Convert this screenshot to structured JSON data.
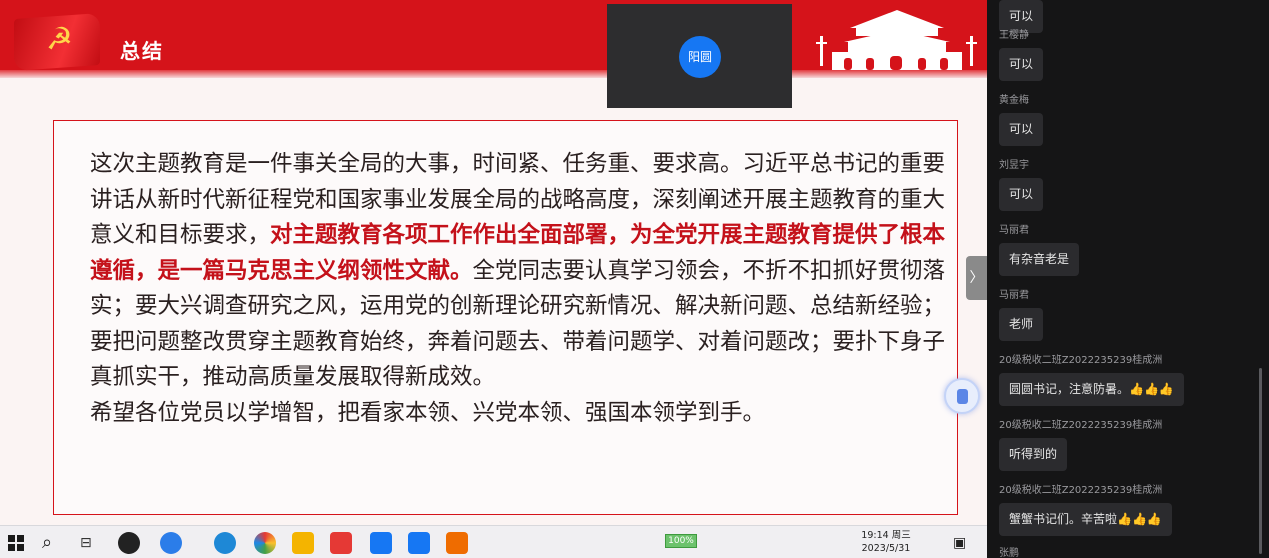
{
  "slide": {
    "title": "总结",
    "paragraph1_a": "这次主题教育是一件事关全局的大事，时间紧、任务重、要求高。习近平总书记的重要讲话从新时代新征程党和国家事业发展全局的战略高度，深刻阐述开展主题教育的重大意义和目标要求，",
    "paragraph1_strong": "对主题教育各项工作作出全面部署，为全党开展主题教育提供了根本遵循，是一篇马克思主义纲领性文献。",
    "paragraph1_b": "全党同志要认真学习领会，不折不扣抓好贯彻落实；要大兴调查研究之风，运用党的创新理论研究新情况、解决新问题、总结新经验；要把问题整改贯穿主题教育始终，奔着问题去、带着问题学、对着问题改；要扑下身子真抓实干，推动高质量发展取得新成效。",
    "paragraph2": "希望各位党员以学增智，把看家本领、兴党本领、强国本领学到手。"
  },
  "video": {
    "participant_name": "阳圆"
  },
  "chat": {
    "messages": [
      {
        "sender": "",
        "text": "可以"
      },
      {
        "sender": "王樱静",
        "text": "可以"
      },
      {
        "sender": "黄金梅",
        "text": "可以"
      },
      {
        "sender": "刘昱宇",
        "text": "可以"
      },
      {
        "sender": "马丽君",
        "text": "有杂音老是"
      },
      {
        "sender": "马丽君",
        "text": "老师"
      },
      {
        "sender": "20级税收二班Z2022235239桂成洲",
        "text": "圆圆书记，注意防暑。👍👍👍"
      },
      {
        "sender": "20级税收二班Z2022235239桂成洲",
        "text": "听得到的"
      },
      {
        "sender": "20级税收二班Z2022235239桂成洲",
        "text": "蟹蟹书记们。辛苦啦👍👍👍"
      },
      {
        "sender": "张鹏",
        "text": ""
      }
    ]
  },
  "taskbar": {
    "battery": "100%",
    "time": "19:14 周三",
    "date": "2023/5/31",
    "collapse_glyph": "〉"
  },
  "icons": {
    "start": "windows-start-icon",
    "search": "search-icon",
    "taskview": "task-view-icon"
  },
  "colors": {
    "party_red": "#d5131a",
    "chat_bg": "#151516",
    "bubble": "#2b2b2e"
  }
}
